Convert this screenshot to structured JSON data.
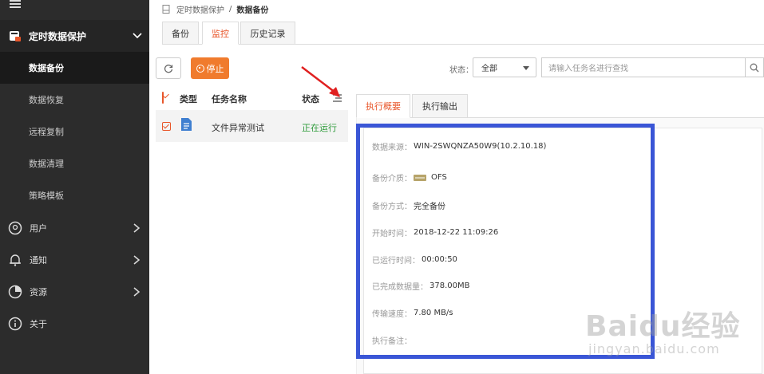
{
  "sidebar": {
    "group_label": "定时数据保护",
    "sub_items": [
      "数据备份",
      "数据恢复",
      "远程复制",
      "数据清理",
      "策略模板"
    ],
    "items": [
      {
        "label": "用户",
        "icon": "user-icon"
      },
      {
        "label": "通知",
        "icon": "bell-icon"
      },
      {
        "label": "资源",
        "icon": "pie-chart-icon"
      },
      {
        "label": "关于",
        "icon": "info-icon"
      }
    ]
  },
  "breadcrumb": {
    "parent": "定时数据保护",
    "separator": "/",
    "current": "数据备份"
  },
  "tabs": [
    "备份",
    "监控",
    "历史记录"
  ],
  "toolbar": {
    "stop_label": "停止",
    "status_label": "状态：",
    "status_value": "全部",
    "search_placeholder": "请输入任务名进行查找"
  },
  "task_list": {
    "headers": {
      "type": "类型",
      "name": "任务名称",
      "status": "状态"
    },
    "rows": [
      {
        "name": "文件异常测试",
        "status": "正在运行"
      }
    ]
  },
  "detail": {
    "tabs": [
      "执行概要",
      "执行输出"
    ],
    "fields": {
      "source": {
        "label": "数据来源：",
        "value": "WIN-2SWQNZA50W9(10.2.10.18)"
      },
      "media": {
        "label": "备份介质：",
        "value": "OFS"
      },
      "method": {
        "label": "备份方式：",
        "value": "完全备份"
      },
      "start": {
        "label": "开始时间：",
        "value": "2018-12-22 11:09:26"
      },
      "elapsed": {
        "label": "已运行时间：",
        "value": "00:00:50"
      },
      "done": {
        "label": "已完成数据量：",
        "value": "378.00MB"
      },
      "speed": {
        "label": "传输速度：",
        "value": "7.80 MB/s"
      },
      "note": {
        "label": "执行备注：",
        "value": ""
      }
    }
  },
  "watermark": {
    "brand": "Baidu经验",
    "url": "jingyan.baidu.com"
  },
  "colors": {
    "accent": "#e8562a",
    "sidebar_bg": "#2c2c2c",
    "running": "#2e9b3b",
    "highlight": "#3a56d6",
    "stop_button": "#f07b2d"
  }
}
